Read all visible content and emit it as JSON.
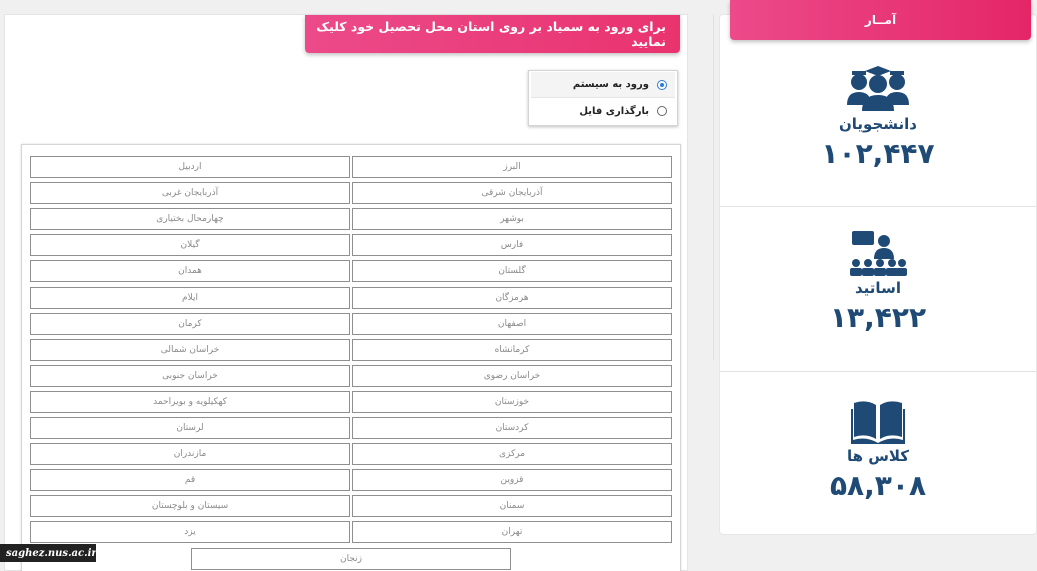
{
  "header": {
    "instruction": "برای ورود به سمیاد بر روی استان محل تحصیل خود کلیک نمایید"
  },
  "mode_options": [
    {
      "label": "ورود به سیستم",
      "selected": true
    },
    {
      "label": "بارگذاری فایل",
      "selected": false
    }
  ],
  "provinces": [
    "البرز",
    "اردبیل",
    "آذربایجان شرقی",
    "آذربایجان غربی",
    "بوشهر",
    "چهارمحال بختیاری",
    "فارس",
    "گیلان",
    "گلستان",
    "همدان",
    "هرمزگان",
    "ایلام",
    "اصفهان",
    "کرمان",
    "کرمانشاه",
    "خراسان شمالی",
    "خراسان رضوی",
    "خراسان جنوبی",
    "خوزستان",
    "کهکیلویه و بویراحمد",
    "کردستان",
    "لرستان",
    "مرکزی",
    "مازندران",
    "قزوین",
    "قم",
    "سمنان",
    "سیستان و بلوچستان",
    "تهران",
    "یزد",
    "زنجان"
  ],
  "watermark": "saghez.nus.ac.ir",
  "stats": {
    "title": "آمــار",
    "students": {
      "label": "دانشجویان",
      "value": "۱۰۲,۴۴۷",
      "icon": "students-icon"
    },
    "professors": {
      "label": "اساتید",
      "value": "۱۳,۴۲۲",
      "icon": "teacher-icon"
    },
    "classes": {
      "label": "کلاس ها",
      "value": "۵۸,۳۰۸",
      "icon": "book-icon"
    }
  },
  "colors": {
    "accent_pink": "#e9336f",
    "stat_blue": "#1f4a75",
    "radio_blue": "#2b7bd6"
  }
}
